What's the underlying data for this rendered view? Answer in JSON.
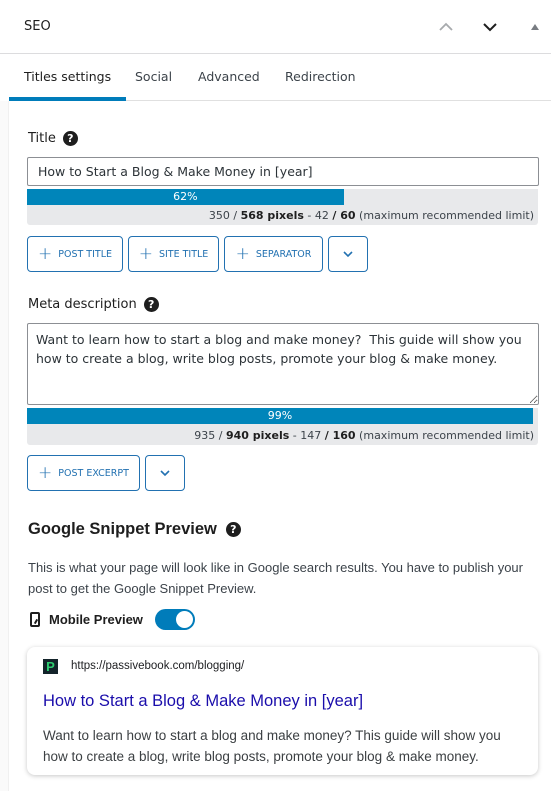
{
  "header": {
    "title": "SEO",
    "icons": [
      "chevron-up-icon",
      "chevron-down-icon",
      "caret-up-icon"
    ]
  },
  "tabs": [
    {
      "label": "Titles settings",
      "active": true
    },
    {
      "label": "Social",
      "active": false
    },
    {
      "label": "Advanced",
      "active": false
    },
    {
      "label": "Redirection",
      "active": false
    }
  ],
  "title_field": {
    "label": "Title",
    "value": "How to Start a Blog & Make Money in [year]",
    "progress_percent": 62,
    "progress_label": "62%",
    "pixels_text": "350 / ",
    "pixels_max": "568 pixels",
    "chars_text": " - 42 ",
    "chars_max": "/ 60",
    "limit_note": " (maximum recommended limit)"
  },
  "title_buttons": [
    {
      "label": "POST TITLE"
    },
    {
      "label": "SITE TITLE"
    },
    {
      "label": "SEPARATOR"
    }
  ],
  "meta_field": {
    "label": "Meta description",
    "value": "Want to learn how to start a blog and make money?  This guide will show you how to create a blog, write blog posts, promote your blog & make money.",
    "progress_percent": 99,
    "progress_label": "99%",
    "pixels_text": "935 / ",
    "pixels_max": "940 pixels",
    "chars_text": " - 147 ",
    "chars_max": "/ 160",
    "limit_note": " (maximum recommended limit)"
  },
  "meta_buttons": [
    {
      "label": "POST EXCERPT"
    }
  ],
  "snippet": {
    "heading": "Google Snippet Preview",
    "description": "This is what your page will look like in Google search results. You have to publish your post to get the Google Snippet Preview.",
    "mobile_preview_label": "Mobile Preview",
    "mobile_preview_on": true,
    "favicon_letter": "P",
    "url": "https://passivebook.com/blogging/",
    "title": "How to Start a Blog & Make Money in [year]",
    "desc": "Want to learn how to start a blog and make money? This guide will show you how to create a blog, write blog posts, promote your blog & make money."
  },
  "colors": {
    "accent": "#007cba",
    "progress": "#0085ba",
    "link": "#1a0dab"
  }
}
